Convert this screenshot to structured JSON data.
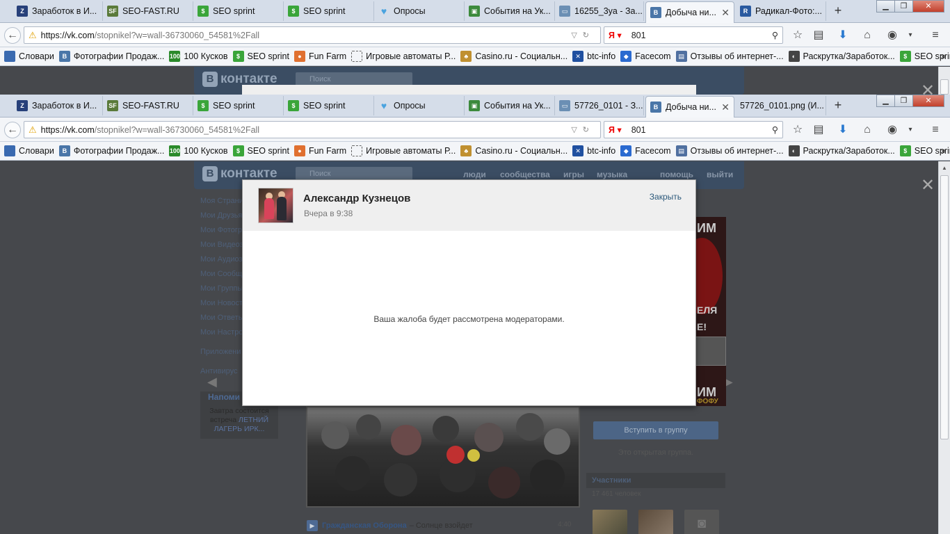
{
  "browser_back": {
    "tabs": [
      {
        "label": "Заработок в И...",
        "fav": "hunt-zona-icon"
      },
      {
        "label": "SEO-FAST.RU",
        "fav": "seo-fast-icon"
      },
      {
        "label": "SEO sprint",
        "fav": "seo-sprint-icon"
      },
      {
        "label": "SEO sprint",
        "fav": "seo-sprint-icon"
      },
      {
        "label": "Опросы",
        "fav": "heart-icon"
      },
      {
        "label": "События на Ук...",
        "fav": "events-icon"
      },
      {
        "label": "16255_3ya - За...",
        "fav": "image-icon"
      },
      {
        "label": "Добыча ни...",
        "fav": "vk-icon"
      },
      {
        "label": "Радикал-Фото:...",
        "fav": "radikal-icon"
      }
    ],
    "url_host": "https://vk.com",
    "url_path": "/stopnikel?w=wall-36730060_54581%2Fall",
    "search_value": "801"
  },
  "browser": {
    "tabs": [
      {
        "label": "Заработок в И...",
        "fav": "hunt-zona-icon"
      },
      {
        "label": "SEO-FAST.RU",
        "fav": "seo-fast-icon"
      },
      {
        "label": "SEO sprint",
        "fav": "seo-sprint-icon"
      },
      {
        "label": "SEO sprint",
        "fav": "seo-sprint-icon"
      },
      {
        "label": "Опросы",
        "fav": "heart-icon"
      },
      {
        "label": "События на Ук...",
        "fav": "events-icon"
      },
      {
        "label": "57726_0101 - З...",
        "fav": "image-icon"
      },
      {
        "label": "Добыча ни...",
        "fav": "vk-icon"
      },
      {
        "label": "57726_0101.png (И...",
        "fav": "blank-icon"
      }
    ],
    "url_host": "https://vk.com",
    "url_path": "/stopnikel?w=wall-36730060_54581%2Fall",
    "search_value": "801",
    "search_engine_letter": "Я"
  },
  "bookmarks": [
    {
      "label": "Словари",
      "icon": "dictionary-icon"
    },
    {
      "label": "Фотографии Продаж...",
      "icon": "vk-icon"
    },
    {
      "label": "100 Кусков",
      "icon": "100-icon"
    },
    {
      "label": "SEO sprint",
      "icon": "seo-sprint-icon"
    },
    {
      "label": "Fun Farm",
      "icon": "peach-icon"
    },
    {
      "label": "Игровые автоматы Р...",
      "icon": "blank-icon"
    },
    {
      "label": "Casino.ru - Социальн...",
      "icon": "casino-icon"
    },
    {
      "label": "btc-info",
      "icon": "btc-icon"
    },
    {
      "label": "Facecom",
      "icon": "facecom-icon"
    },
    {
      "label": "Отзывы об интернет-...",
      "icon": "reviews-icon"
    },
    {
      "label": "Раскрутка/Заработок...",
      "icon": "promo-icon"
    },
    {
      "label": "SEO sprint",
      "icon": "seo-sprint-icon"
    }
  ],
  "vk": {
    "logo_text": "контакте",
    "search_placeholder": "Поиск",
    "nav": [
      "люди",
      "сообщества",
      "игры",
      "музыка",
      "помощь",
      "выйти"
    ],
    "menu": [
      "Моя Страни",
      "Мои Друзья",
      "Мои Фотогр",
      "Мои Видеоз",
      "Мои Аудиоз",
      "Мои Сообщ",
      "Мои Группы",
      "Мои Новост",
      "Мои Ответы",
      "Мои Настро",
      "Приложени",
      "Антивирус"
    ],
    "reminder_title": "Напоми",
    "reminder_text_pre": "Завтра состоится встреча",
    "reminder_link": "ЛЕТНИЙ ЛАГЕРЬ ИРК...",
    "poster_text": [
      "ИМ",
      "ЕЛЯ",
      "Е!",
      "ИМ",
      "ФОФУ"
    ],
    "join_button": "Вступить в группу",
    "open_group": "Это открытая группа.",
    "members_title": "Участники",
    "members_count": "17 461 человек",
    "audio_artist": "Гражданская Оборона",
    "audio_title": "– Солнце взойдет",
    "audio_duration": "4:40"
  },
  "modal": {
    "author": "Александр Кузнецов",
    "time": "Вчера в 9:38",
    "close_label": "Закрыть",
    "message": "Ваша жалоба будет рассмотрена модераторами."
  },
  "colors": {
    "vk_header": "#3b4d63",
    "overlay": "#46484c",
    "link": "#2b587a",
    "join_button": "#4c6586"
  }
}
